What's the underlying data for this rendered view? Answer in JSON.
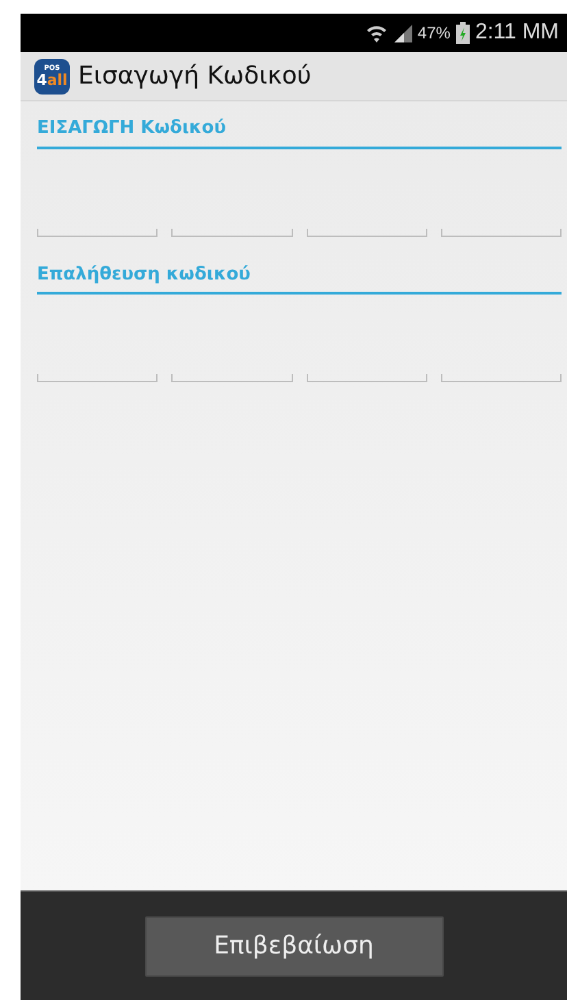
{
  "status_bar": {
    "battery": "47%",
    "time": "2:11 MM"
  },
  "app_bar": {
    "logo_top": "POS",
    "logo_digit": "4",
    "logo_word": "all",
    "title": "Εισαγωγή Κωδικού"
  },
  "sections": [
    {
      "heading": "ΕΙΣΑΓΩΓΗ Κωδικού",
      "fields": [
        {
          "kind": "digit"
        },
        {
          "kind": "digit"
        },
        {
          "kind": "digit"
        },
        {
          "kind": "digit"
        }
      ]
    },
    {
      "heading": "Επαλήθευση κωδικού",
      "fields": [
        {
          "kind": "digit"
        },
        {
          "kind": "digit"
        },
        {
          "kind": "digit"
        },
        {
          "kind": "digit"
        }
      ]
    }
  ],
  "confirm_button": "Επιβεβαίωση"
}
